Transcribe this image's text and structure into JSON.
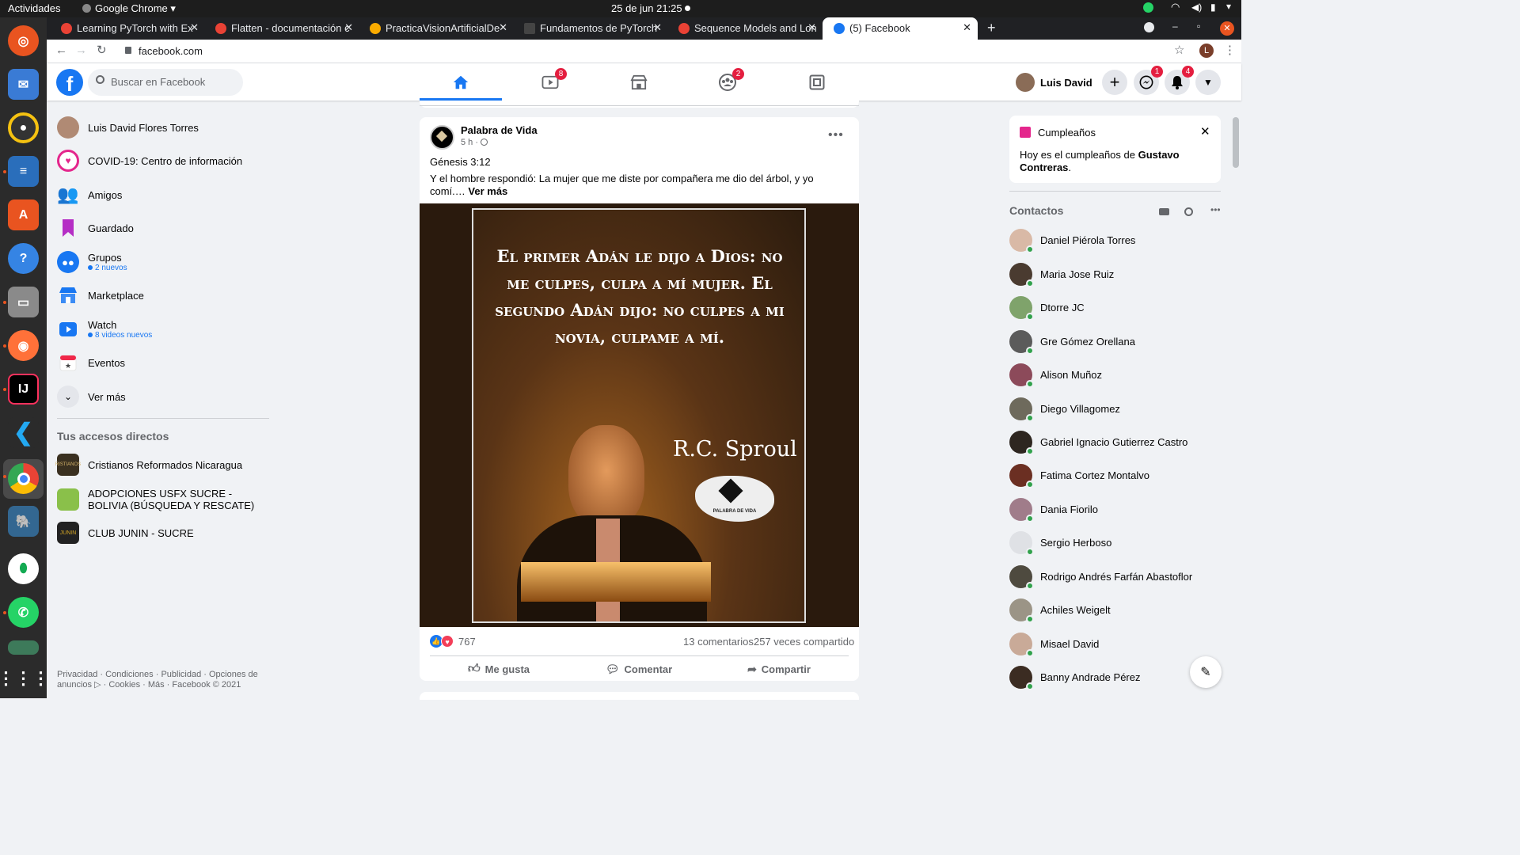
{
  "system": {
    "activities": "Actividades",
    "app_menu": "Google Chrome",
    "datetime": "25 de jun  21:25"
  },
  "browser": {
    "tabs": [
      {
        "label": "Learning PyTorch with Ex",
        "favicon_color": "#e94235"
      },
      {
        "label": "Flatten - documentación c",
        "favicon_color": "#e94235"
      },
      {
        "label": "PracticaVisionArtificialDe",
        "favicon_color": "#f9ab00"
      },
      {
        "label": "Fundamentos de PyTorch",
        "favicon_color": "#444444"
      },
      {
        "label": "Sequence Models and Lon",
        "favicon_color": "#e94235"
      },
      {
        "label": "(5) Facebook",
        "favicon_color": "#1877f2"
      }
    ],
    "url": "facebook.com",
    "profile_initial": "L"
  },
  "header": {
    "search_placeholder": "Buscar en Facebook",
    "watch_badge": "8",
    "groups_badge": "2",
    "user_name": "Luis David",
    "messenger_badge": "1",
    "notifications_badge": "4"
  },
  "left_menu": {
    "items": [
      {
        "label": "Luis David Flores Torres",
        "sub": ""
      },
      {
        "label": "COVID-19: Centro de información",
        "sub": ""
      },
      {
        "label": "Amigos",
        "sub": ""
      },
      {
        "label": "Guardado",
        "sub": ""
      },
      {
        "label": "Grupos",
        "sub": "2 nuevos"
      },
      {
        "label": "Marketplace",
        "sub": ""
      },
      {
        "label": "Watch",
        "sub": "8 videos nuevos"
      },
      {
        "label": "Eventos",
        "sub": ""
      },
      {
        "label": "Ver más",
        "sub": ""
      }
    ],
    "shortcuts_title": "Tus accesos directos",
    "shortcuts": [
      {
        "label": "Cristianos Reformados Nicaragua"
      },
      {
        "label": "ADOPCIONES USFX SUCRE - BOLIVIA (BÚSQUEDA Y RESCATE)"
      },
      {
        "label": "CLUB JUNIN - SUCRE"
      }
    ],
    "footer": "Privacidad · Condiciones · Publicidad · Opciones de anuncios ▷ · Cookies · Más · Facebook © 2021"
  },
  "post": {
    "author": "Palabra de Vida",
    "time": "5 h ·",
    "title": "Génesis 3:12",
    "body": "Y el hombre respondió: La mujer que me diste por compañera me dio del árbol, y yo comí.… ",
    "see_more": "Ver más",
    "image_quote": "El primer Adán le dijo a Dios: no me culpes, culpa a mí mujer. El segundo Adán dijo: no culpes a mi novia, culpame a mí.",
    "image_author": "R.C. Sproul",
    "image_logo_text": "PALABRA DE VIDA",
    "reactions": "767",
    "comments": "13 comentarios",
    "shares": "257 veces compartido",
    "like_label": "Me gusta",
    "comment_label": "Comentar",
    "share_label": "Compartir"
  },
  "right": {
    "birthday_title": "Cumpleaños",
    "birthday_text": "Hoy es el cumpleaños de ",
    "birthday_name": "Gustavo Contreras",
    "contacts_title": "Contactos",
    "contacts": [
      {
        "name": "Daniel Piérola Torres"
      },
      {
        "name": "Maria Jose Ruiz"
      },
      {
        "name": "Dtorre JC"
      },
      {
        "name": "Gre Gómez Orellana"
      },
      {
        "name": "Alison Muñoz"
      },
      {
        "name": "Diego Villagomez"
      },
      {
        "name": "Gabriel Ignacio Gutierrez Castro"
      },
      {
        "name": "Fatima Cortez Montalvo"
      },
      {
        "name": "Dania Fiorilo"
      },
      {
        "name": "Sergio Herboso"
      },
      {
        "name": "Rodrigo Andrés Farfán Abastoflor"
      },
      {
        "name": "Achiles Weigelt"
      },
      {
        "name": "Misael David"
      },
      {
        "name": "Banny Andrade Pérez"
      }
    ]
  },
  "colors": {
    "fb_blue": "#1877f2",
    "online": "#31a24c",
    "badge_red": "#e41e3f"
  }
}
